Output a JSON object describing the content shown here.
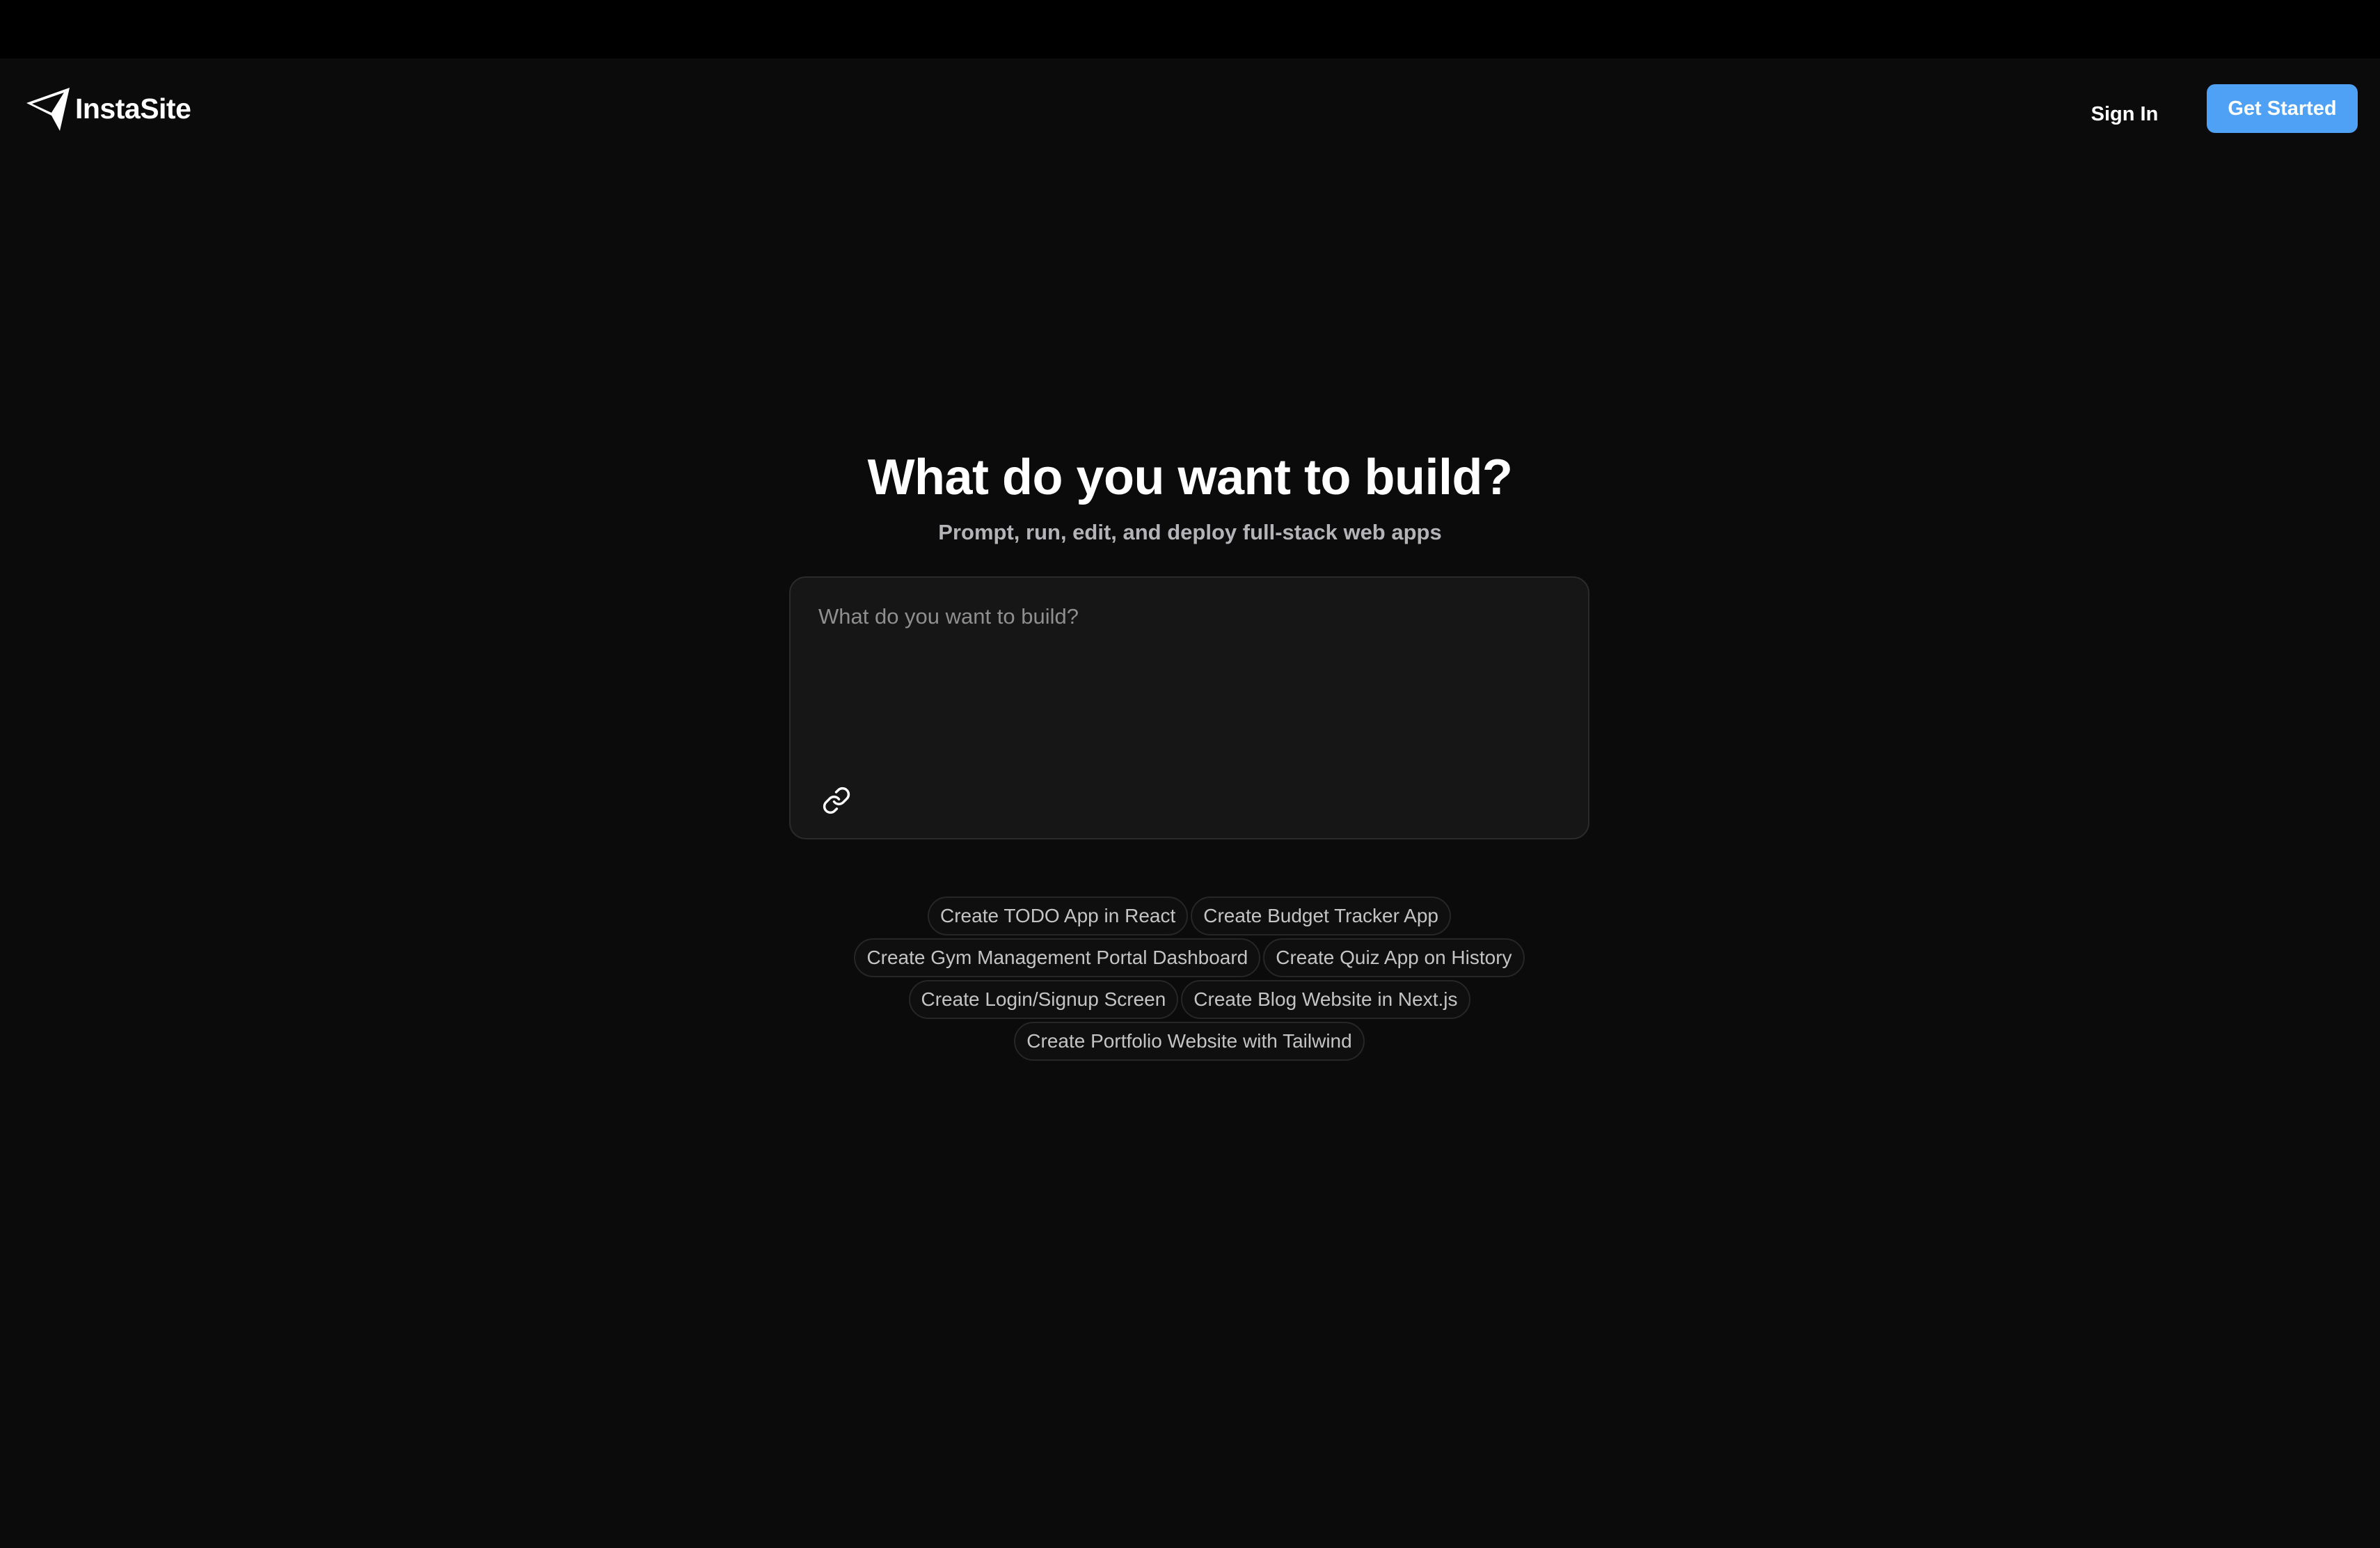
{
  "brand": {
    "name": "InstaSite",
    "logo_icon": "paper-plane-logo-icon"
  },
  "header": {
    "signin_label": "Sign In",
    "get_started_label": "Get Started"
  },
  "hero": {
    "title": "What do you want to build?",
    "subtitle": "Prompt, run, edit, and deploy full-stack web apps"
  },
  "prompt": {
    "placeholder": "What do you want to build?",
    "value": "",
    "attach_icon": "link-icon"
  },
  "suggestions": [
    [
      "Create TODO App in React",
      "Create Budget Tracker App"
    ],
    [
      "Create Gym Management Portal Dashboard",
      "Create Quiz App on History"
    ],
    [
      "Create Login/Signup Screen",
      "Create Blog Website in Next.js"
    ],
    [
      "Create Portfolio Website with Tailwind"
    ]
  ],
  "colors": {
    "background": "#0b0b0b",
    "topbar": "#000000",
    "accent": "#4ea1f5",
    "prompt_bg": "#161616",
    "chip_border": "#262626"
  }
}
